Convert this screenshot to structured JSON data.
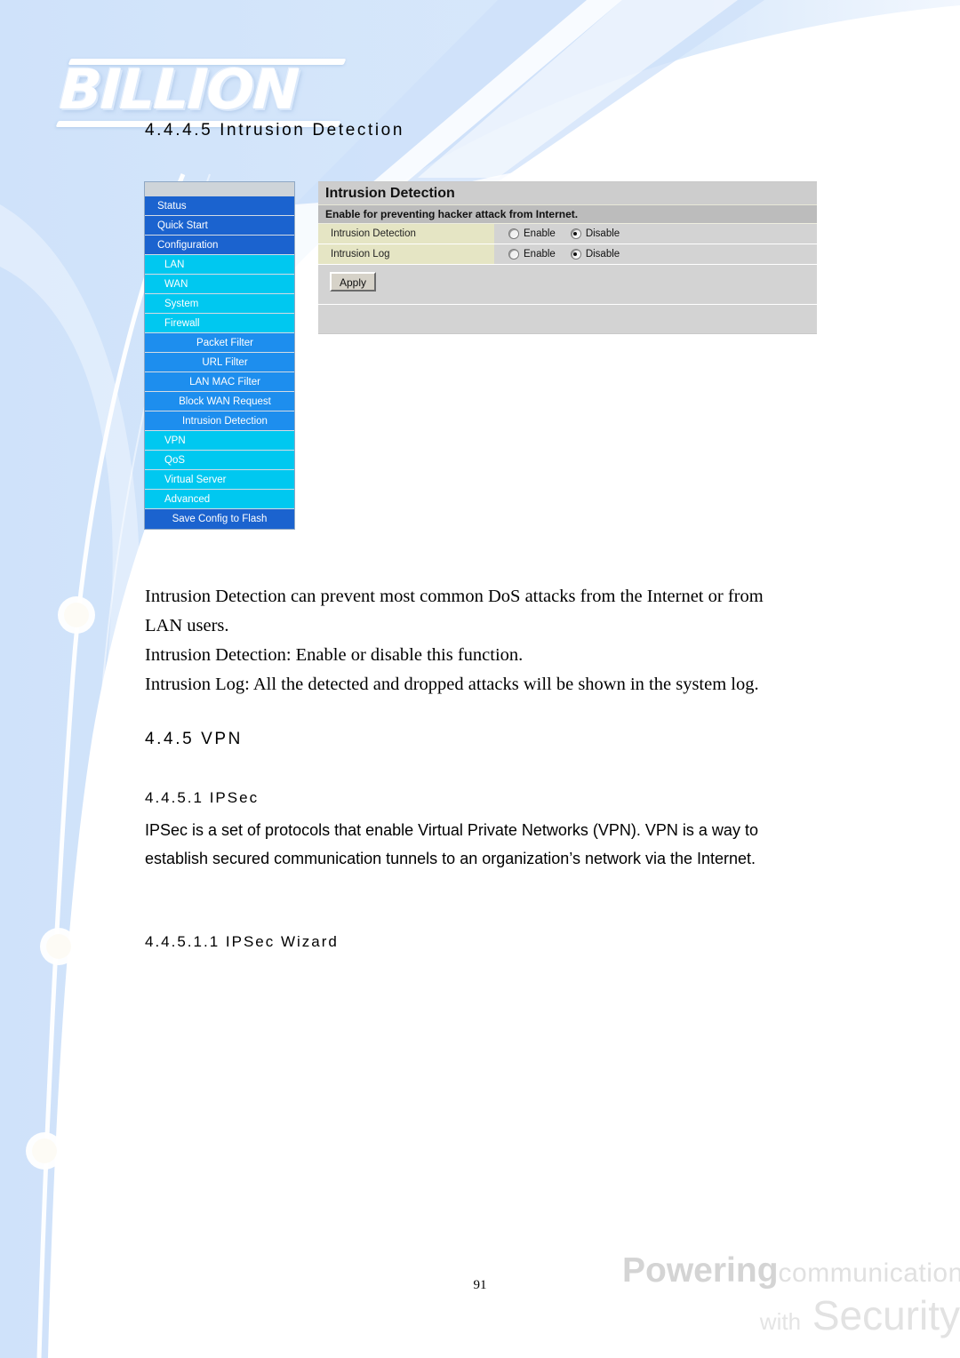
{
  "document": {
    "page_number": "91",
    "brand_logo_text": "BILLION"
  },
  "headings": {
    "section_4445": "4.4.4.5   Intrusion Detection",
    "section_445": "4.4.5   VPN",
    "section_4451": "4.4.5.1   IPSec",
    "section_44511": "4.4.5.1.1   IPSec Wizard"
  },
  "router_ui": {
    "sidebar": {
      "items": [
        {
          "label": "Status",
          "level": 0
        },
        {
          "label": "Quick Start",
          "level": 0
        },
        {
          "label": "Configuration",
          "level": 0
        },
        {
          "label": "LAN",
          "level": 1
        },
        {
          "label": "WAN",
          "level": 1
        },
        {
          "label": "System",
          "level": 1
        },
        {
          "label": "Firewall",
          "level": 1
        },
        {
          "label": "Packet Filter",
          "level": 2
        },
        {
          "label": "URL Filter",
          "level": 2
        },
        {
          "label": "LAN MAC Filter",
          "level": 2
        },
        {
          "label": "Block WAN Request",
          "level": 2
        },
        {
          "label": "Intrusion Detection",
          "level": 2
        },
        {
          "label": "VPN",
          "level": 1
        },
        {
          "label": "QoS",
          "level": 1
        },
        {
          "label": "Virtual Server",
          "level": 1
        },
        {
          "label": "Advanced",
          "level": 1
        },
        {
          "label": "Save Config to Flash",
          "level": 3
        }
      ]
    },
    "panel": {
      "title": "Intrusion Detection",
      "subtitle": "Enable for preventing hacker attack from Internet.",
      "rows": [
        {
          "label": "Intrusion Detection",
          "enable_label": "Enable",
          "disable_label": "Disable",
          "selected": "Disable"
        },
        {
          "label": "Intrusion Log",
          "enable_label": "Enable",
          "disable_label": "Disable",
          "selected": "Disable"
        }
      ],
      "apply_label": "Apply"
    }
  },
  "body": {
    "intrusion_paragraph_line1": "Intrusion Detection can prevent most common DoS attacks from the Internet or from",
    "intrusion_paragraph_line2": "LAN users.",
    "intrusion_paragraph_line3": "Intrusion Detection: Enable or disable this function.",
    "intrusion_paragraph_line4": "Intrusion Log: All the detected and dropped attacks will be shown in the system log.",
    "ipsec_paragraph": "IPSec is a set of protocols that enable Virtual Private Networks (VPN). VPN is a way to establish secured communication tunnels to an organization’s network via the Internet."
  },
  "watermark": {
    "line1_bold": "Powering",
    "line1_light": "communications",
    "line2_small": "with",
    "line2_large": "Security"
  },
  "colors": {
    "nav_level0": "#1b63cf",
    "nav_level1": "#00c8f0",
    "nav_level2": "#1d8eee",
    "panel_label_bg": "#e5e5c4",
    "panel_value_bg": "#d3d3d3",
    "page_accent": "#d6e7fa"
  }
}
